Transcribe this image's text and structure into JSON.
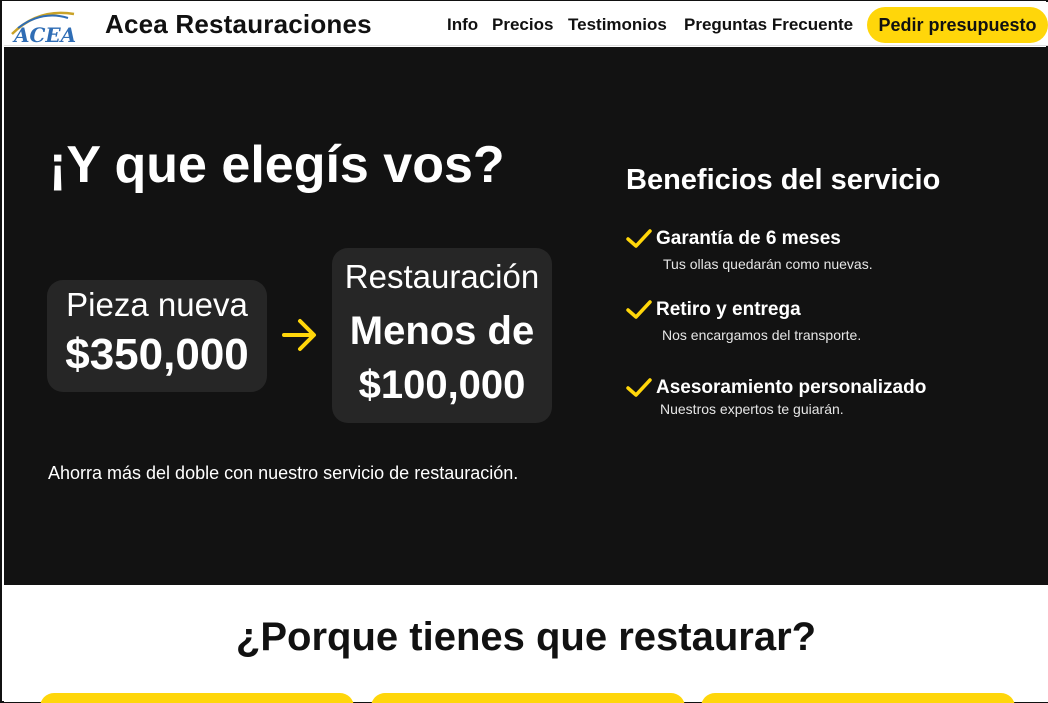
{
  "header": {
    "brand": "Acea Restauraciones",
    "logo_text": "ACEA",
    "nav": [
      "Info",
      "Precios",
      "Testimonios",
      "Preguntas Frecuente"
    ],
    "cta_label": "Pedir presupuesto"
  },
  "hero": {
    "title": "¡Y que elegís vos?",
    "old_label": "Pieza nueva",
    "old_price": "$350,000",
    "new_label": "Restauración",
    "new_price_line1": "Menos de",
    "new_price_line2": "$100,000",
    "note": "Ahorra más del doble con nuestro servicio de restauración."
  },
  "benefits": {
    "title": "Beneficios del servicio",
    "items": [
      {
        "title": "Garantía de 6 meses",
        "desc": "Tus ollas quedarán como nuevas."
      },
      {
        "title": "Retiro y entrega",
        "desc": "Nos encargamos del transporte."
      },
      {
        "title": "Asesoramiento personalizado",
        "desc": "Nuestros expertos te guiarán."
      }
    ]
  },
  "lower": {
    "title": "¿Porque tienes que restaurar?"
  },
  "colors": {
    "accent": "#ffd60a",
    "hero_bg": "#121212",
    "card_bg": "#262626",
    "logo_blue": "#2f6db5"
  }
}
